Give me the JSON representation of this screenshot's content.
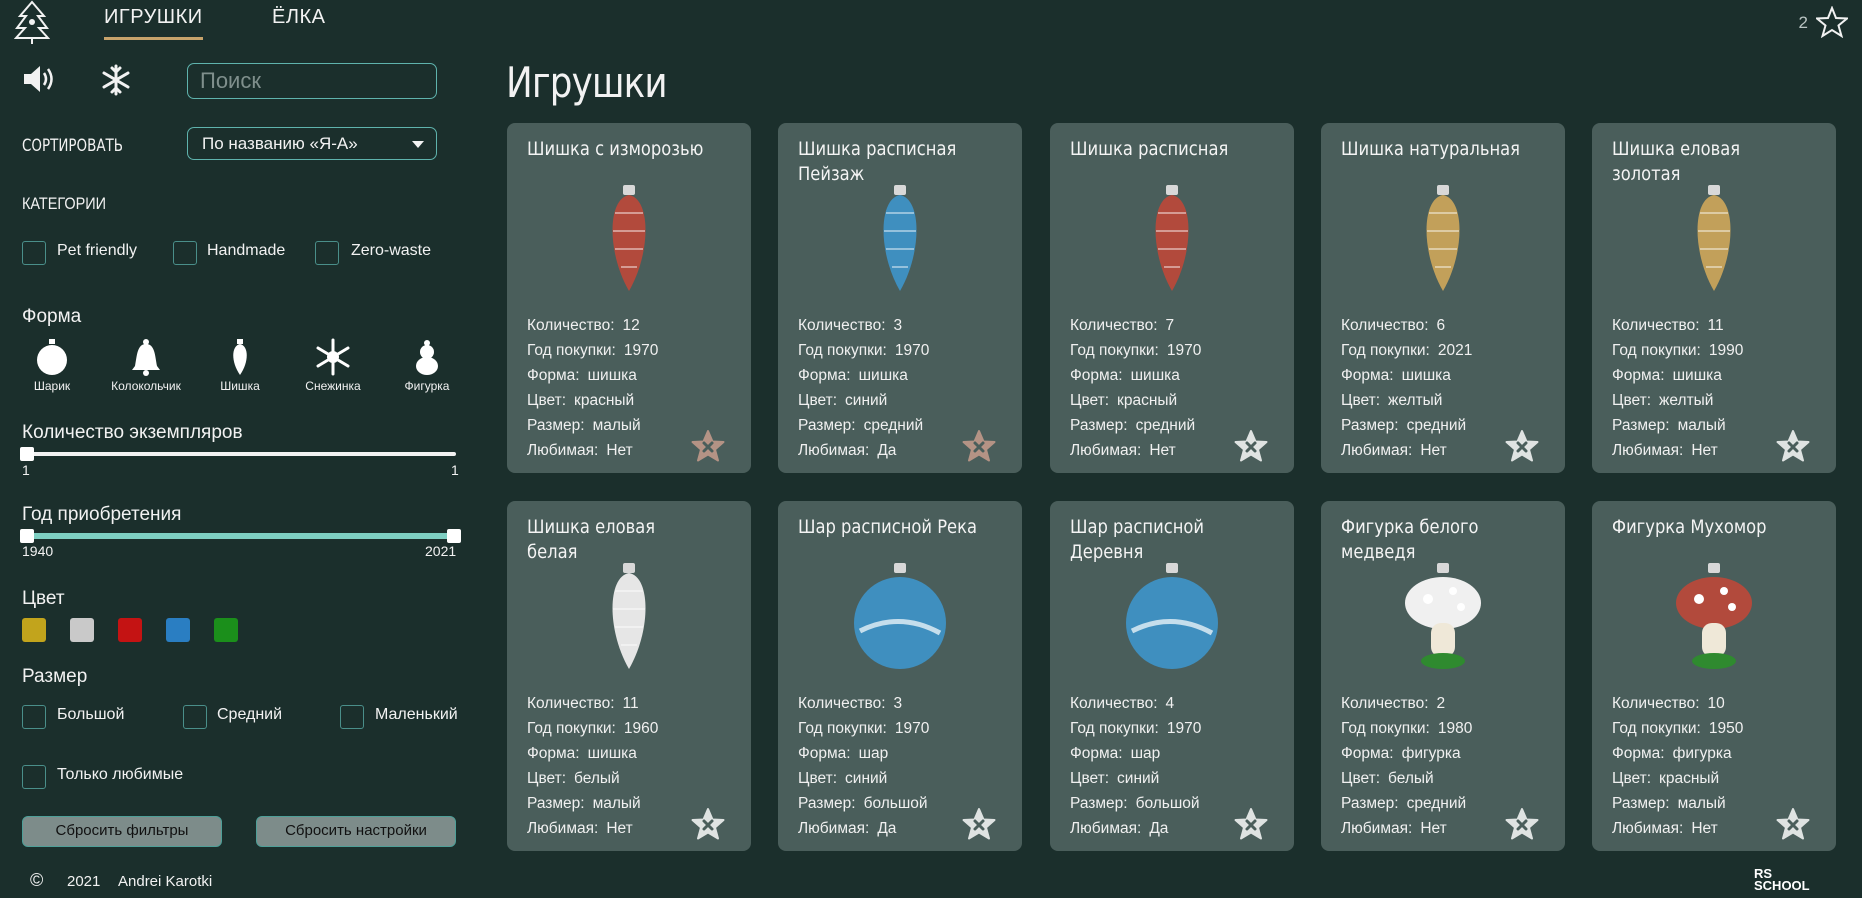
{
  "header": {
    "nav": [
      "ИГРУШКИ",
      "ЁЛКА"
    ],
    "favorites_count": "2"
  },
  "sidebar": {
    "search_placeholder": "Поиск",
    "sort_label": "СОРТИРОВАТЬ",
    "sort_value": "По названию «Я-А»",
    "categories_label": "КАТЕГОРИИ",
    "categories": [
      "Pet friendly",
      "Handmade",
      "Zero-waste"
    ],
    "shape_label": "Форма",
    "shapes": [
      "Шарик",
      "Колокольчик",
      "Шишка",
      "Снежинка",
      "Фигурка"
    ],
    "count_label": "Количество экземпляров",
    "count_min": "1",
    "count_max": "1",
    "year_label": "Год приобретения",
    "year_min": "1940",
    "year_max": "2021",
    "color_label": "Цвет",
    "colors": [
      "#c2a41c",
      "#c9c9c9",
      "#c41313",
      "#2a7ec2",
      "#1b8f1b"
    ],
    "size_label": "Размер",
    "sizes": [
      "Большой",
      "Средний",
      "Маленький"
    ],
    "favorites_only": "Только любимые",
    "reset_filters": "Сбросить фильтры",
    "reset_settings": "Сбросить настройки"
  },
  "main": {
    "title": "Игрушки",
    "info_keys": {
      "count": "Количество:",
      "year": "Год покупки:",
      "shape": "Форма:",
      "color": "Цвет:",
      "size": "Размер:",
      "favorite": "Любимая:"
    },
    "cards": [
      {
        "title": "Шишка с изморозью",
        "count": "12",
        "year": "1970",
        "shape": "шишка",
        "color": "красный",
        "size": "малый",
        "favorite": "Нет",
        "star": "marked"
      },
      {
        "title": "Шишка расписная Пейзаж",
        "count": "3",
        "year": "1970",
        "shape": "шишка",
        "color": "синий",
        "size": "средний",
        "favorite": "Да",
        "star": "marked"
      },
      {
        "title": "Шишка расписная",
        "count": "7",
        "year": "1970",
        "shape": "шишка",
        "color": "красный",
        "size": "средний",
        "favorite": "Нет",
        "star": "empty"
      },
      {
        "title": "Шишка натуральная",
        "count": "6",
        "year": "2021",
        "shape": "шишка",
        "color": "желтый",
        "size": "средний",
        "favorite": "Нет",
        "star": "empty"
      },
      {
        "title": "Шишка еловая золотая",
        "count": "11",
        "year": "1990",
        "shape": "шишка",
        "color": "желтый",
        "size": "малый",
        "favorite": "Нет",
        "star": "empty"
      },
      {
        "title": "Шишка еловая белая",
        "count": "11",
        "year": "1960",
        "shape": "шишка",
        "color": "белый",
        "size": "малый",
        "favorite": "Нет",
        "star": "empty"
      },
      {
        "title": "Шар расписной Река",
        "count": "3",
        "year": "1970",
        "shape": "шар",
        "color": "синий",
        "size": "большой",
        "favorite": "Да",
        "star": "empty"
      },
      {
        "title": "Шар расписной Деревня",
        "count": "4",
        "year": "1970",
        "shape": "шар",
        "color": "синий",
        "size": "большой",
        "favorite": "Да",
        "star": "empty"
      },
      {
        "title": "Фигурка белого медведя",
        "count": "2",
        "year": "1980",
        "shape": "фигурка",
        "color": "белый",
        "size": "средний",
        "favorite": "Нет",
        "star": "empty"
      },
      {
        "title": "Фигурка Мухомор",
        "count": "10",
        "year": "1950",
        "shape": "фигурка",
        "color": "красный",
        "size": "малый",
        "favorite": "Нет",
        "star": "empty"
      }
    ]
  },
  "footer": {
    "copyright": "©",
    "year": "2021",
    "author": "Andrei Karotki",
    "school_logo": "RS SCHOOL"
  }
}
